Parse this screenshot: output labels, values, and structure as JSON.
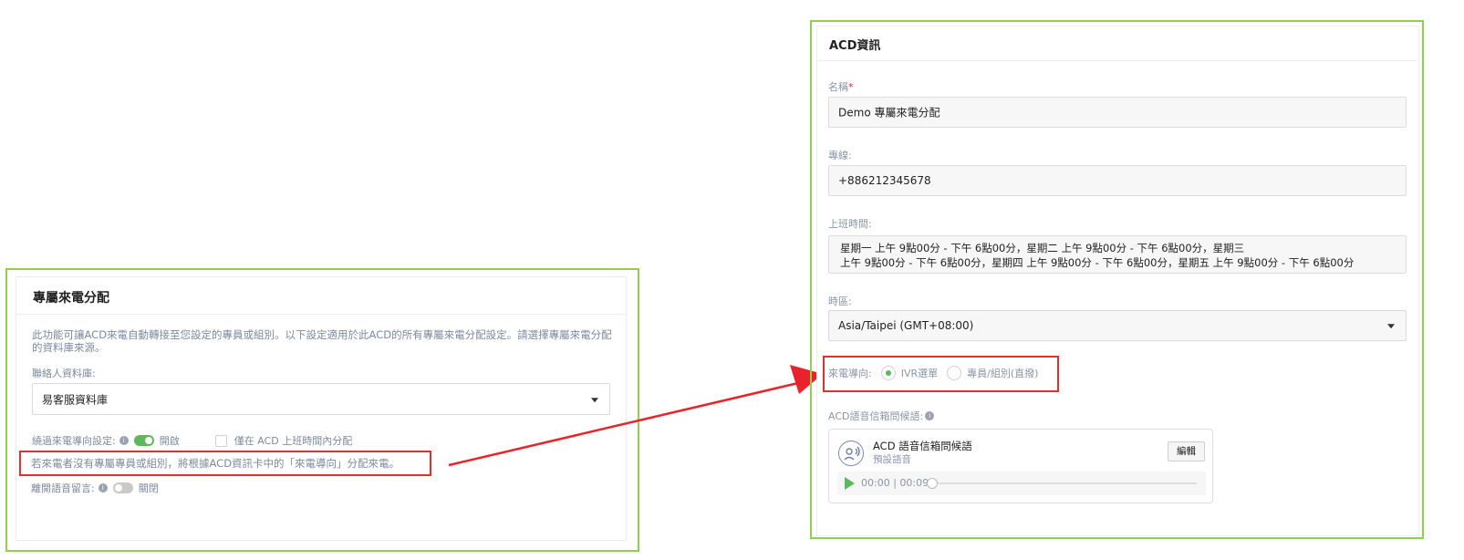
{
  "left": {
    "title": "專屬來電分配",
    "description": "此功能可讓ACD來電自動轉接至您設定的專員或組別。以下設定適用於此ACD的所有專屬來電分配設定。請選擇專屬來電分配的資料庫來源。",
    "contact_db_label": "聯絡人資料庫:",
    "contact_db_value": "易客服資料庫",
    "bypass_label": "繞過來電導向設定:",
    "bypass_toggle": {
      "state": "on",
      "state_text": "開啟"
    },
    "only_in_hours_label": "僅在 ACD 上班時間內分配",
    "note": "若來電者沒有專屬專員或組別，將根據ACD資訊卡中的「來電導向」分配來電。",
    "leave_voicemail_label": "離開語音留言:",
    "voicemail_toggle": {
      "state": "off",
      "state_text": "關閉"
    },
    "info_glyph": "i"
  },
  "right": {
    "title": "ACD資訊",
    "name_label": "名稱",
    "required_mark": "*",
    "name_value": "Demo 專屬來電分配",
    "line_label": "專線:",
    "line_value": "+886212345678",
    "hours_label": "上班時間:",
    "hours_line1": "星期一  上午 9點00分 - 下午 6點00分，星期二  上午 9點00分 - 下午 6點00分，星期三",
    "hours_line2": "上午 9點00分 - 下午 6點00分，星期四  上午 9點00分 - 下午 6點00分，星期五  上午 9點00分 - 下午 6點00分",
    "timezone_label": "時區:",
    "timezone_value": "Asia/Taipei (GMT+08:00)",
    "routing_label": "來電導向:",
    "routing_options": [
      {
        "label": "IVR選單",
        "selected": true
      },
      {
        "label": "專員/組別(直撥)",
        "selected": false
      }
    ],
    "greeting_label": "ACD語音信箱問候語:",
    "greeting": {
      "title": "ACD 語音信箱問候語",
      "subtitle": "預設語音",
      "edit_label": "編輯",
      "time": "00:00 | 00:09",
      "progress": 0
    }
  },
  "colors": {
    "frame_green": "#8fd14f",
    "highlight_red": "#e03131",
    "toggle_green": "#5cb85c",
    "label_gray": "#7c8a9c"
  },
  "icons": [
    "info-icon",
    "dropdown-caret-icon",
    "voice-greeting-icon",
    "play-icon",
    "arrow-annotation"
  ]
}
